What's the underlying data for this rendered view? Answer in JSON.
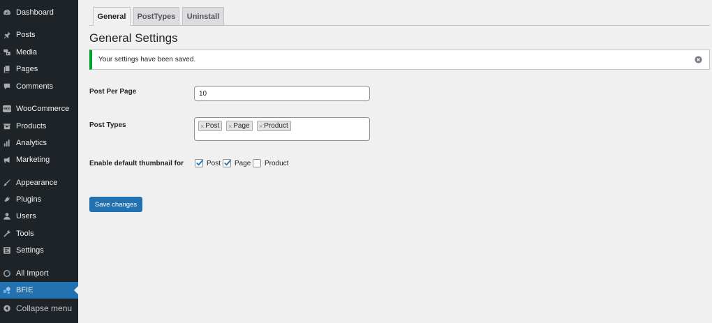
{
  "sidebar": {
    "items": [
      {
        "label": "Dashboard",
        "icon": "dashboard-icon"
      },
      {
        "label": "Posts",
        "icon": "pin-icon"
      },
      {
        "label": "Media",
        "icon": "media-icon"
      },
      {
        "label": "Pages",
        "icon": "pages-icon"
      },
      {
        "label": "Comments",
        "icon": "comment-icon"
      },
      {
        "label": "WooCommerce",
        "icon": "woocommerce-icon",
        "badge": "woo"
      },
      {
        "label": "Products",
        "icon": "archive-icon"
      },
      {
        "label": "Analytics",
        "icon": "bar-chart-icon"
      },
      {
        "label": "Marketing",
        "icon": "megaphone-icon"
      },
      {
        "label": "Appearance",
        "icon": "brush-icon"
      },
      {
        "label": "Plugins",
        "icon": "plug-icon"
      },
      {
        "label": "Users",
        "icon": "user-icon"
      },
      {
        "label": "Tools",
        "icon": "wrench-icon"
      },
      {
        "label": "Settings",
        "icon": "settings-icon"
      },
      {
        "label": "All Import",
        "icon": "import-icon"
      },
      {
        "label": "BFIE",
        "icon": "bfie-icon"
      }
    ],
    "collapse_label": "Collapse menu"
  },
  "tabs": [
    {
      "label": "General"
    },
    {
      "label": "PostTypes"
    },
    {
      "label": "Uninstall"
    }
  ],
  "page_title": "General Settings",
  "notice": {
    "text": "Your settings have been saved.",
    "color": "#00a32a"
  },
  "fields": {
    "posts_per_page": {
      "label": "Post Per Page",
      "value": "10"
    },
    "post_types": {
      "label": "Post Types",
      "selected": [
        "Post",
        "Page",
        "Product"
      ]
    },
    "thumbnail": {
      "label": "Enable default thumbnail for",
      "options": [
        {
          "label": "Post",
          "checked": true
        },
        {
          "label": "Page",
          "checked": true
        },
        {
          "label": "Product",
          "checked": false
        }
      ]
    }
  },
  "save_label": "Save changes",
  "colors": {
    "accent": "#2271b1",
    "sidebar_bg": "#1d2327",
    "success": "#00a32a"
  }
}
